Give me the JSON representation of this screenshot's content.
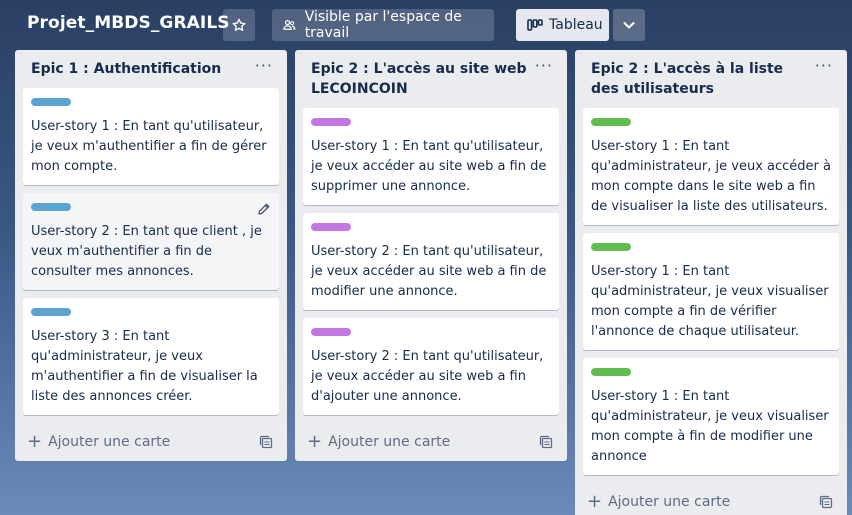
{
  "header": {
    "board_title": "Projet_MBDS_GRAILS",
    "visibility_label": "Visible par l'espace de travail",
    "view_label": "Tableau"
  },
  "colors": {
    "label_blue": "#5ba4cf",
    "label_purple": "#c377e0",
    "label_green": "#61bd4f"
  },
  "add_card_label": "Ajouter une carte",
  "lists": [
    {
      "title": "Epic 1 : Authentification",
      "cards": [
        {
          "label_color": "blue",
          "text": "User-story 1 : En tant qu'utilisateur, je veux m'authentifier a fin de gérer mon compte."
        },
        {
          "label_color": "blue",
          "text": "User-story 2 : En tant que client , je veux m'authentifier a fin de consulter mes annonces."
        },
        {
          "label_color": "blue",
          "text": "User-story 3 : En tant qu'administrateur, je veux m'authentifier a fin de visualiser la liste des annonces créer."
        }
      ]
    },
    {
      "title": "Epic 2 : L'accès au site web LECOINCOIN",
      "cards": [
        {
          "label_color": "purple",
          "text": "User-story 1 : En tant qu'utilisateur, je veux accéder au site web a fin de supprimer une annonce."
        },
        {
          "label_color": "purple",
          "text": "User-story 2 : En tant qu'utilisateur, je veux accéder au site web a fin de modifier une annonce."
        },
        {
          "label_color": "purple",
          "text": "User-story 2 : En tant qu'utilisateur, je veux accéder au site web a fin d'ajouter une annonce."
        }
      ]
    },
    {
      "title": "Epic 2 : L'accès à la liste des utilisateurs",
      "cards": [
        {
          "label_color": "green",
          "text": "User-story 1 : En tant qu'administrateur, je veux accéder à mon compte dans le site web a fin de visualiser la liste des utilisateurs."
        },
        {
          "label_color": "green",
          "text": "User-story 1 : En tant qu'administrateur, je veux visualiser mon compte a fin de vérifier l'annonce de chaque utilisateur."
        },
        {
          "label_color": "green",
          "text": "User-story 1 : En tant qu'administrateur, je veux visualiser mon compte à fin de modifier une annonce"
        }
      ]
    }
  ]
}
